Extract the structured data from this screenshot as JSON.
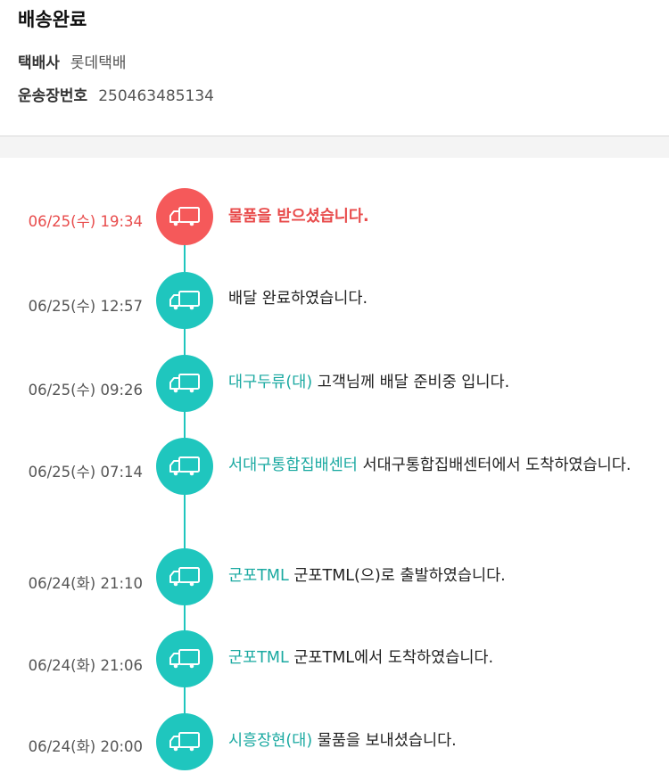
{
  "header": {
    "status": "배송완료",
    "courier_label": "택배사",
    "courier_value": "롯데택배",
    "tracking_label": "운송장번호",
    "tracking_value": "250463485134"
  },
  "colors": {
    "accent": "#1fc6be",
    "latest": "#f5595a",
    "location_text": "#1aa9a1"
  },
  "timeline": [
    {
      "time": "06/25(수) 19:34",
      "location": "",
      "message": "물품을 받으셨습니다.",
      "icon": "delivery-truck-icon"
    },
    {
      "time": "06/25(수) 12:57",
      "location": "",
      "message": "배달 완료하였습니다.",
      "icon": "delivery-truck-icon"
    },
    {
      "time": "06/25(수) 09:26",
      "location": "대구두류(대)",
      "message": " 고객님께 배달 준비중 입니다.",
      "icon": "delivery-truck-icon"
    },
    {
      "time": "06/25(수) 07:14",
      "location": "서대구통합집배센터",
      "message": " 서대구통합집배센터에서 도착하였습니다.",
      "icon": "delivery-truck-icon"
    },
    {
      "time": "06/24(화) 21:10",
      "location": "군포TML",
      "message": " 군포TML(으)로 출발하였습니다.",
      "icon": "delivery-truck-icon"
    },
    {
      "time": "06/24(화) 21:06",
      "location": "군포TML",
      "message": " 군포TML에서 도착하였습니다.",
      "icon": "delivery-truck-icon"
    },
    {
      "time": "06/24(화) 20:00",
      "location": "시흥장현(대)",
      "message": " 물품을 보내셨습니다.",
      "icon": "delivery-truck-icon"
    }
  ]
}
